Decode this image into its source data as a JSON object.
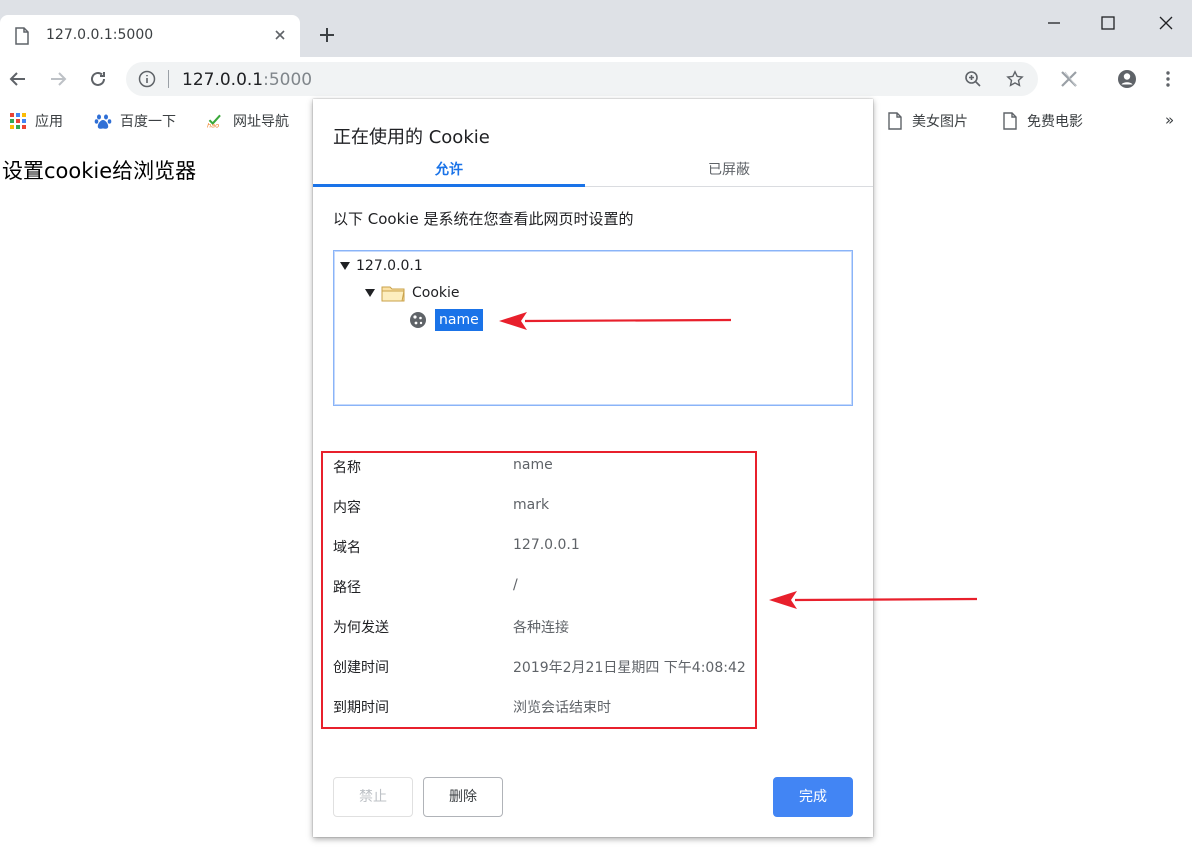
{
  "browser": {
    "tab_title": "127.0.0.1:5000",
    "url_host": "127.0.0.1",
    "url_port": ":5000"
  },
  "bookmarks": [
    {
      "label": "应用",
      "icon": "apps-grid-icon"
    },
    {
      "label": "百度一下",
      "icon": "baidu-paw-icon"
    },
    {
      "label": "网址导航",
      "icon": "hao123-icon"
    },
    {
      "label": "美女图片",
      "icon": "page-icon"
    },
    {
      "label": "免费电影",
      "icon": "page-icon"
    }
  ],
  "bookmarks_overflow": "»",
  "page": {
    "heading": "设置cookie给浏览器"
  },
  "dialog": {
    "title": "正在使用的 Cookie",
    "tabs": [
      {
        "label": "允许",
        "active": true
      },
      {
        "label": "已屏蔽",
        "active": false
      }
    ],
    "description": "以下 Cookie 是系统在您查看此网页时设置的",
    "tree": {
      "root": "127.0.0.1",
      "folder": "Cookie",
      "item": "name"
    },
    "details": [
      {
        "label": "名称",
        "value": "name"
      },
      {
        "label": "内容",
        "value": "mark"
      },
      {
        "label": "域名",
        "value": "127.0.0.1"
      },
      {
        "label": "路径",
        "value": "/"
      },
      {
        "label": "为何发送",
        "value": "各种连接"
      },
      {
        "label": "创建时间",
        "value": "2019年2月21日星期四 下午4:08:42"
      },
      {
        "label": "到期时间",
        "value": "浏览会话结束时"
      }
    ],
    "buttons": {
      "block": "禁止",
      "delete": "删除",
      "done": "完成"
    }
  },
  "colors": {
    "accent": "#1a73e8",
    "done_button": "#4285f4",
    "annotation_red": "#e8202c"
  }
}
